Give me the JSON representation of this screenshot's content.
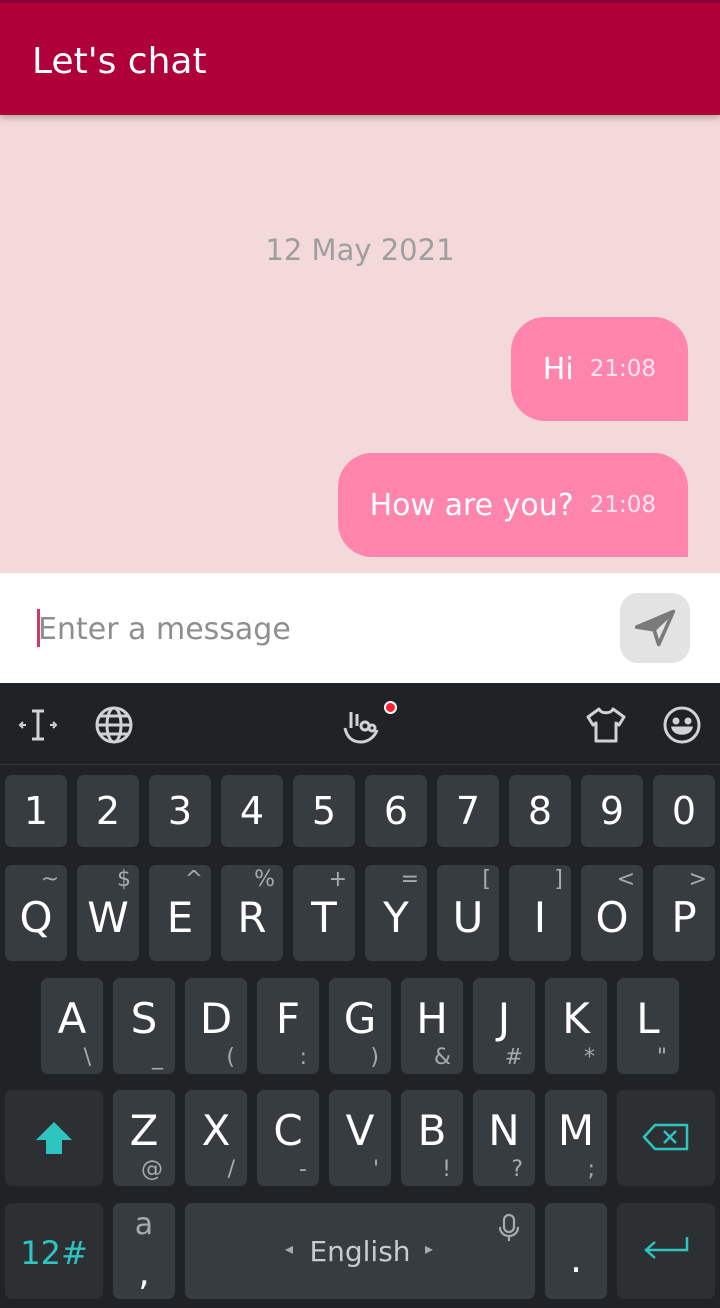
{
  "app": {
    "title": "Let's chat"
  },
  "chat": {
    "date": "12 May 2021",
    "messages": [
      {
        "text": "Hi",
        "time": "21:08"
      },
      {
        "text": "How are you?",
        "time": "21:08"
      }
    ]
  },
  "composer": {
    "placeholder": "Enter a message"
  },
  "keyboard": {
    "toolbar_icons": [
      "cursor-move-icon",
      "globe-icon",
      "gesture-hand-icon",
      "theme-shirt-icon",
      "emoji-icon"
    ],
    "number_row": [
      "1",
      "2",
      "3",
      "4",
      "5",
      "6",
      "7",
      "8",
      "9",
      "0"
    ],
    "row1": [
      {
        "key": "Q",
        "hint": "~"
      },
      {
        "key": "W",
        "hint": "$"
      },
      {
        "key": "E",
        "hint": "^"
      },
      {
        "key": "R",
        "hint": "%"
      },
      {
        "key": "T",
        "hint": "+"
      },
      {
        "key": "Y",
        "hint": "="
      },
      {
        "key": "U",
        "hint": "["
      },
      {
        "key": "I",
        "hint": "]"
      },
      {
        "key": "O",
        "hint": "<"
      },
      {
        "key": "P",
        "hint": ">"
      }
    ],
    "row2": [
      {
        "key": "A",
        "hint": "\\"
      },
      {
        "key": "S",
        "hint": "_"
      },
      {
        "key": "D",
        "hint": "("
      },
      {
        "key": "F",
        "hint": ":"
      },
      {
        "key": "G",
        "hint": ")"
      },
      {
        "key": "H",
        "hint": "&"
      },
      {
        "key": "J",
        "hint": "#"
      },
      {
        "key": "K",
        "hint": "*"
      },
      {
        "key": "L",
        "hint": "\""
      }
    ],
    "row3": [
      {
        "key": "Z",
        "hint": "@"
      },
      {
        "key": "X",
        "hint": "/"
      },
      {
        "key": "C",
        "hint": "-"
      },
      {
        "key": "V",
        "hint": "'"
      },
      {
        "key": "B",
        "hint": "!"
      },
      {
        "key": "N",
        "hint": "?"
      },
      {
        "key": "M",
        "hint": ";"
      }
    ],
    "symbols_key": "12#",
    "comma_key": {
      "top": "a",
      "bottom": ","
    },
    "space_label": "English",
    "period_key": ".",
    "accent_color": "#2ec4c0"
  }
}
